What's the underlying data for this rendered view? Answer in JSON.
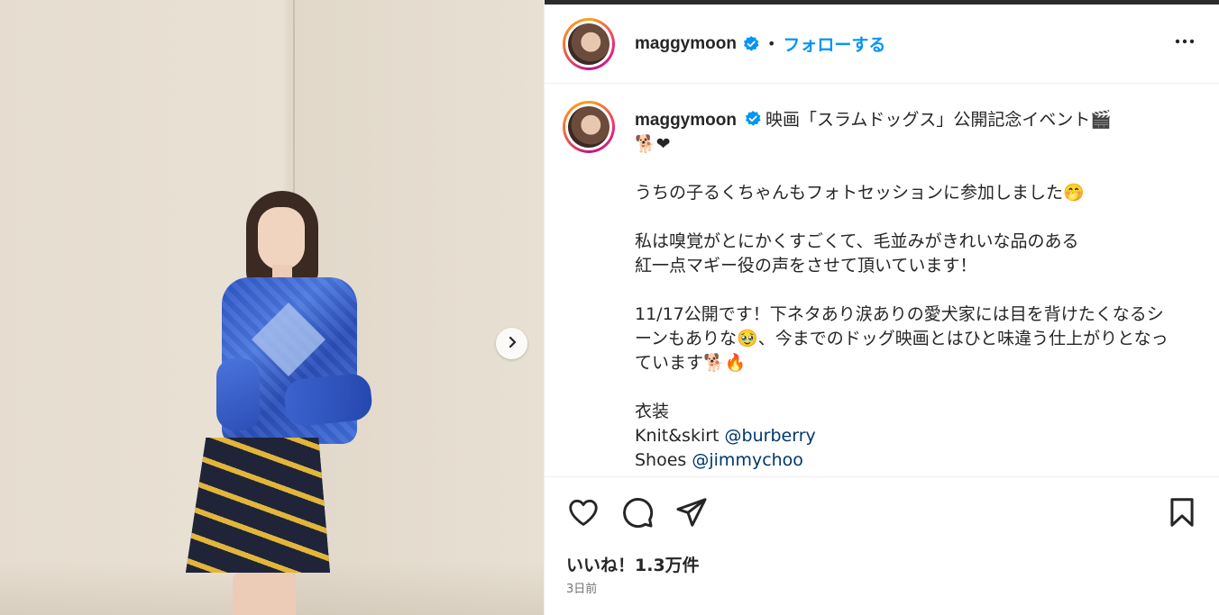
{
  "post": {
    "username": "maggymoon",
    "follow_label": "フォローする",
    "separator": "•",
    "caption": {
      "line1": "映画「スラムドッグス」公開記念イベント🎬",
      "line2": "🐕❤",
      "para1": "うちの子るくちゃんもフォトセッションに参加しました🤭",
      "para2": "私は嗅覚がとにかくすごくて、毛並みがきれいな品のある\n紅一点マギー役の声をさせて頂いています！",
      "para3": "11/17公開です！下ネタあり涙ありの愛犬家には目を背けたくなるシーンもありな🥹、今までのドッグ映画とはひと味違う仕上がりとなっています🐕🔥",
      "costume_label": "衣装",
      "knit_label": "Knit&skirt",
      "knit_mention": "@burberry",
      "shoes_label": "Shoes",
      "shoes_mention": "@jimmychoo"
    },
    "likes": "いいね！1.3万件",
    "date": "3日前"
  },
  "icons": {
    "verified": "verified-badge-icon",
    "more": "more-options-icon",
    "like": "heart-icon",
    "comment": "comment-icon",
    "share": "share-icon",
    "save": "bookmark-icon",
    "next": "chevron-right-icon"
  },
  "colors": {
    "accent": "#0095f6",
    "mention": "#00376b",
    "verified": "#0095f6",
    "text": "#262626",
    "muted": "#737373"
  }
}
